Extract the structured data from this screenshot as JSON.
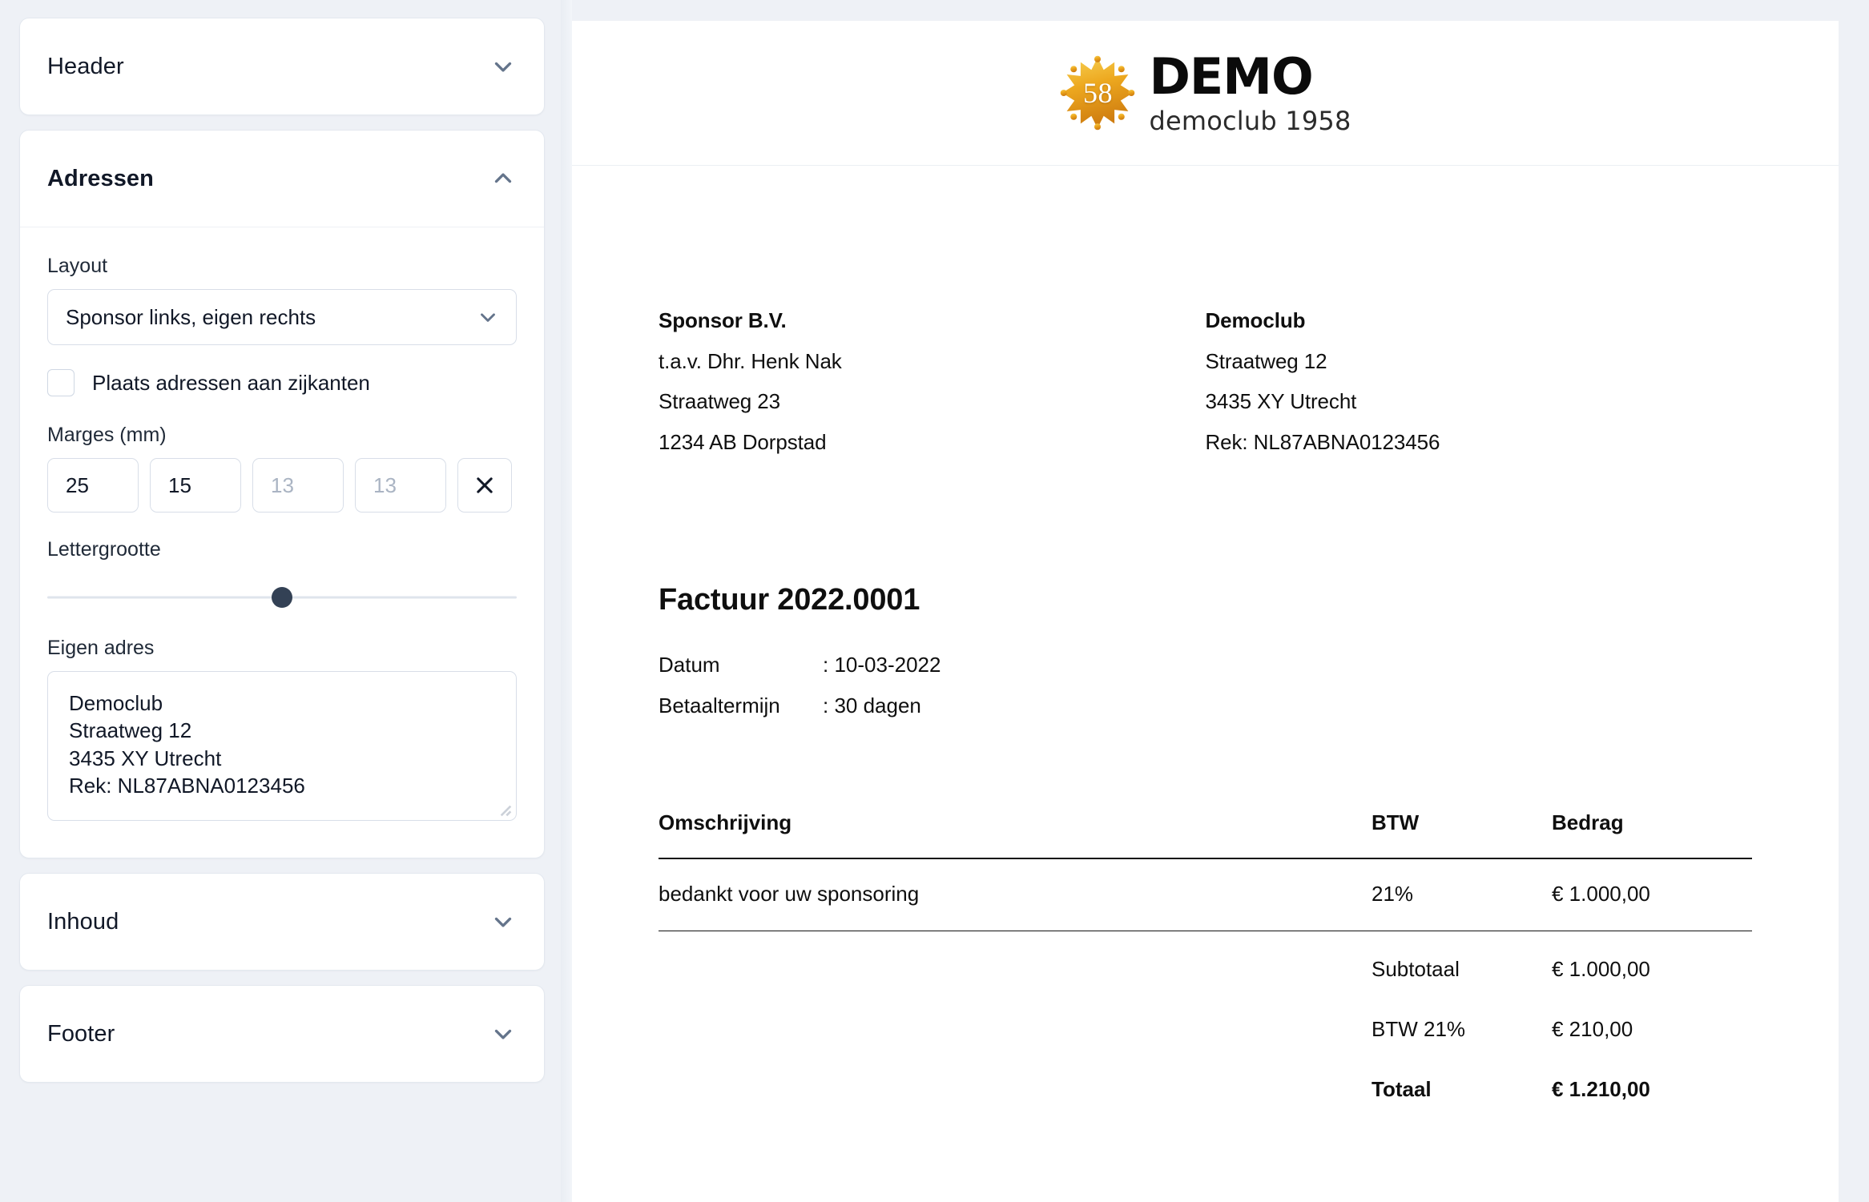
{
  "sidebar": {
    "panels": [
      {
        "title": "Header",
        "expanded": false,
        "chevron": "chevron-down-icon"
      },
      {
        "title": "Adressen",
        "expanded": true,
        "chevron": "chevron-up-icon"
      },
      {
        "title": "Inhoud",
        "expanded": false,
        "chevron": "chevron-down-icon"
      },
      {
        "title": "Footer",
        "expanded": false,
        "chevron": "chevron-down-icon"
      }
    ],
    "adressen": {
      "layout_label": "Layout",
      "layout_value": "Sponsor links, eigen rechts",
      "layout_options": [
        "Sponsor links, eigen rechts"
      ],
      "layout_chevron": "chevron-down-icon",
      "side_checkbox_label": "Plaats adressen aan zijkanten",
      "side_checkbox_checked": false,
      "margins_label": "Marges (mm)",
      "margins": [
        {
          "value": "25",
          "placeholder": "",
          "is_placeholder": false
        },
        {
          "value": "15",
          "placeholder": "",
          "is_placeholder": false
        },
        {
          "value": "13",
          "placeholder": "13",
          "is_placeholder": true
        },
        {
          "value": "13",
          "placeholder": "13",
          "is_placeholder": true
        }
      ],
      "clear_icon": "close-icon",
      "font_size_label": "Lettergrootte",
      "font_size_percent": 50,
      "own_address_label": "Eigen adres",
      "own_address_lines": [
        "Democlub",
        "Straatweg 12",
        "3435 XY Utrecht",
        "Rek: NL87ABNA0123456"
      ],
      "resize_handle": "resize-grip-icon"
    }
  },
  "document": {
    "logo": {
      "badge_number": "58",
      "brand": "DEMO",
      "tagline": "democlub 1958",
      "badge_color_light": "#f5c542",
      "badge_color_dark": "#d98c1a"
    },
    "sponsor_address": [
      "Sponsor B.V.",
      "t.a.v. Dhr. Henk Nak",
      "Straatweg 23",
      "1234 AB Dorpstad"
    ],
    "own_address": [
      "Democlub",
      "Straatweg 12",
      "3435 XY Utrecht",
      "Rek: NL87ABNA0123456"
    ],
    "invoice_title": "Factuur 2022.0001",
    "meta": [
      {
        "key": "Datum",
        "value": ": 10-03-2022"
      },
      {
        "key": "Betaaltermijn",
        "value": ": 30 dagen"
      }
    ],
    "table": {
      "headers": {
        "description": "Omschrijving",
        "vat": "BTW",
        "amount": "Bedrag"
      },
      "rows": [
        {
          "description": "bedankt voor uw sponsoring",
          "vat": "21%",
          "amount": "€ 1.000,00"
        }
      ]
    },
    "totals": [
      {
        "label": "Subtotaal",
        "value": "€ 1.000,00",
        "grand": false
      },
      {
        "label": "BTW 21%",
        "value": "€ 210,00",
        "grand": false
      },
      {
        "label": "Totaal",
        "value": "€ 1.210,00",
        "grand": true
      }
    ]
  }
}
